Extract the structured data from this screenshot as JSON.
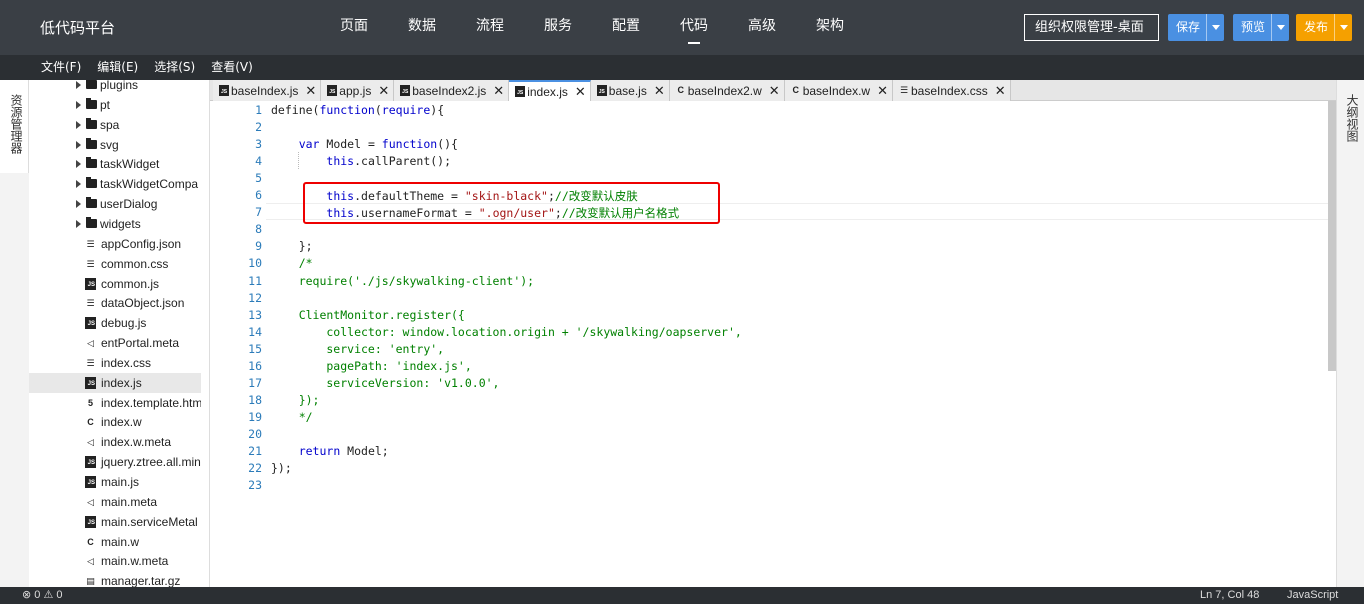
{
  "app": {
    "title": "低代码平台"
  },
  "nav": {
    "items": [
      "页面",
      "数据",
      "流程",
      "服务",
      "配置",
      "代码",
      "高级",
      "架构"
    ],
    "active_index": 5
  },
  "toolbar": {
    "project": "组织权限管理-桌面",
    "save_label": "保存",
    "preview_label": "预览",
    "publish_label": "发布"
  },
  "menubar": {
    "items": [
      "文件(F)",
      "编辑(E)",
      "选择(S)",
      "查看(V)"
    ]
  },
  "left_panel": {
    "tab_label": "资源管理器"
  },
  "right_panel": {
    "tab_label": "大纲视图"
  },
  "file_tree": {
    "items": [
      {
        "label": "plugins",
        "kind": "folder",
        "icon": "folder-icon"
      },
      {
        "label": "pt",
        "kind": "folder",
        "icon": "folder-icon"
      },
      {
        "label": "spa",
        "kind": "folder",
        "icon": "folder-icon"
      },
      {
        "label": "svg",
        "kind": "folder",
        "icon": "folder-icon"
      },
      {
        "label": "taskWidget",
        "kind": "folder",
        "icon": "folder-icon"
      },
      {
        "label": "taskWidgetCompa",
        "kind": "folder",
        "icon": "folder-icon"
      },
      {
        "label": "userDialog",
        "kind": "folder",
        "icon": "folder-icon"
      },
      {
        "label": "widgets",
        "kind": "folder",
        "icon": "folder-icon"
      },
      {
        "label": "appConfig.json",
        "kind": "file",
        "icon": "json-file-icon",
        "glyph": "☰"
      },
      {
        "label": "common.css",
        "kind": "file",
        "icon": "css-file-icon",
        "glyph": "☰"
      },
      {
        "label": "common.js",
        "kind": "file",
        "icon": "js-file-icon",
        "glyph": "JS"
      },
      {
        "label": "dataObject.json",
        "kind": "file",
        "icon": "json-file-icon",
        "glyph": "☰"
      },
      {
        "label": "debug.js",
        "kind": "file",
        "icon": "js-file-icon",
        "glyph": "JS"
      },
      {
        "label": "entPortal.meta",
        "kind": "file",
        "icon": "meta-file-icon",
        "glyph": "◁"
      },
      {
        "label": "index.css",
        "kind": "file",
        "icon": "css-file-icon",
        "glyph": "☰"
      },
      {
        "label": "index.js",
        "kind": "file",
        "icon": "js-file-icon",
        "glyph": "JS",
        "selected": true
      },
      {
        "label": "index.template.htm",
        "kind": "file",
        "icon": "html-file-icon",
        "glyph": "5"
      },
      {
        "label": "index.w",
        "kind": "file",
        "icon": "w-file-icon",
        "glyph": "C"
      },
      {
        "label": "index.w.meta",
        "kind": "file",
        "icon": "meta-file-icon",
        "glyph": "◁"
      },
      {
        "label": "jquery.ztree.all.min",
        "kind": "file",
        "icon": "js-file-icon",
        "glyph": "JS"
      },
      {
        "label": "main.js",
        "kind": "file",
        "icon": "js-file-icon",
        "glyph": "JS"
      },
      {
        "label": "main.meta",
        "kind": "file",
        "icon": "meta-file-icon",
        "glyph": "◁"
      },
      {
        "label": "main.serviceMetal",
        "kind": "file",
        "icon": "js-file-icon",
        "glyph": "JS"
      },
      {
        "label": "main.w",
        "kind": "file",
        "icon": "w-file-icon",
        "glyph": "C"
      },
      {
        "label": "main.w.meta",
        "kind": "file",
        "icon": "meta-file-icon",
        "glyph": "◁"
      },
      {
        "label": "manager.tar.gz",
        "kind": "file",
        "icon": "archive-file-icon",
        "glyph": "▤"
      }
    ]
  },
  "tabs": [
    {
      "label": "baseIndex.js",
      "icon": "js",
      "active": false
    },
    {
      "label": "app.js",
      "icon": "js",
      "active": false
    },
    {
      "label": "baseIndex2.js",
      "icon": "js",
      "active": false
    },
    {
      "label": "index.js",
      "icon": "js",
      "active": true
    },
    {
      "label": "base.js",
      "icon": "js",
      "active": false
    },
    {
      "label": "baseIndex2.w",
      "icon": "w",
      "active": false
    },
    {
      "label": "baseIndex.w",
      "icon": "w",
      "active": false
    },
    {
      "label": "baseIndex.css",
      "icon": "css",
      "active": false
    }
  ],
  "code": {
    "lines": [
      [
        [
          "p",
          "define("
        ],
        [
          "k",
          "function"
        ],
        [
          "p",
          "("
        ],
        [
          "k",
          "require"
        ],
        [
          "p",
          "){"
        ]
      ],
      [],
      [
        [
          "p",
          "    "
        ],
        [
          "k",
          "var"
        ],
        [
          "p",
          " Model = "
        ],
        [
          "k",
          "function"
        ],
        [
          "p",
          "(){"
        ]
      ],
      [
        [
          "p",
          "        "
        ],
        [
          "k",
          "this"
        ],
        [
          "p",
          ".callParent();"
        ]
      ],
      [],
      [
        [
          "p",
          "        "
        ],
        [
          "k",
          "this"
        ],
        [
          "p",
          ".defaultTheme = "
        ],
        [
          "s",
          "\"skin-black\""
        ],
        [
          "p",
          ";"
        ],
        [
          "c",
          "//改变默认皮肤"
        ]
      ],
      [
        [
          "p",
          "        "
        ],
        [
          "k",
          "this"
        ],
        [
          "p",
          ".usernameFormat = "
        ],
        [
          "s",
          "\".ogn/user\""
        ],
        [
          "p",
          ";"
        ],
        [
          "c",
          "//改变默认用户名格式"
        ]
      ],
      [],
      [
        [
          "p",
          "    };"
        ]
      ],
      [
        [
          "c",
          "    /*"
        ]
      ],
      [
        [
          "c",
          "    require('./js/skywalking-client');"
        ]
      ],
      [],
      [
        [
          "c",
          "    ClientMonitor.register({"
        ]
      ],
      [
        [
          "c",
          "        collector: window.location.origin + '/skywalking/oapserver',"
        ]
      ],
      [
        [
          "c",
          "        service: 'entry',"
        ]
      ],
      [
        [
          "c",
          "        pagePath: 'index.js',"
        ]
      ],
      [
        [
          "c",
          "        serviceVersion: 'v1.0.0',"
        ]
      ],
      [
        [
          "c",
          "    });"
        ]
      ],
      [
        [
          "c",
          "    */"
        ]
      ],
      [],
      [
        [
          "p",
          "    "
        ],
        [
          "k",
          "return"
        ],
        [
          "p",
          " Model;"
        ]
      ],
      [
        [
          "p",
          "});"
        ]
      ],
      []
    ]
  },
  "status": {
    "errors": "0",
    "warnings": "0",
    "cursor": "Ln 7, Col 48",
    "language": "JavaScript"
  },
  "colors": {
    "accent": "#4a90e2",
    "publish": "#f5a000",
    "header_bg": "#3a3f45",
    "highlight_box": "#e00000"
  }
}
